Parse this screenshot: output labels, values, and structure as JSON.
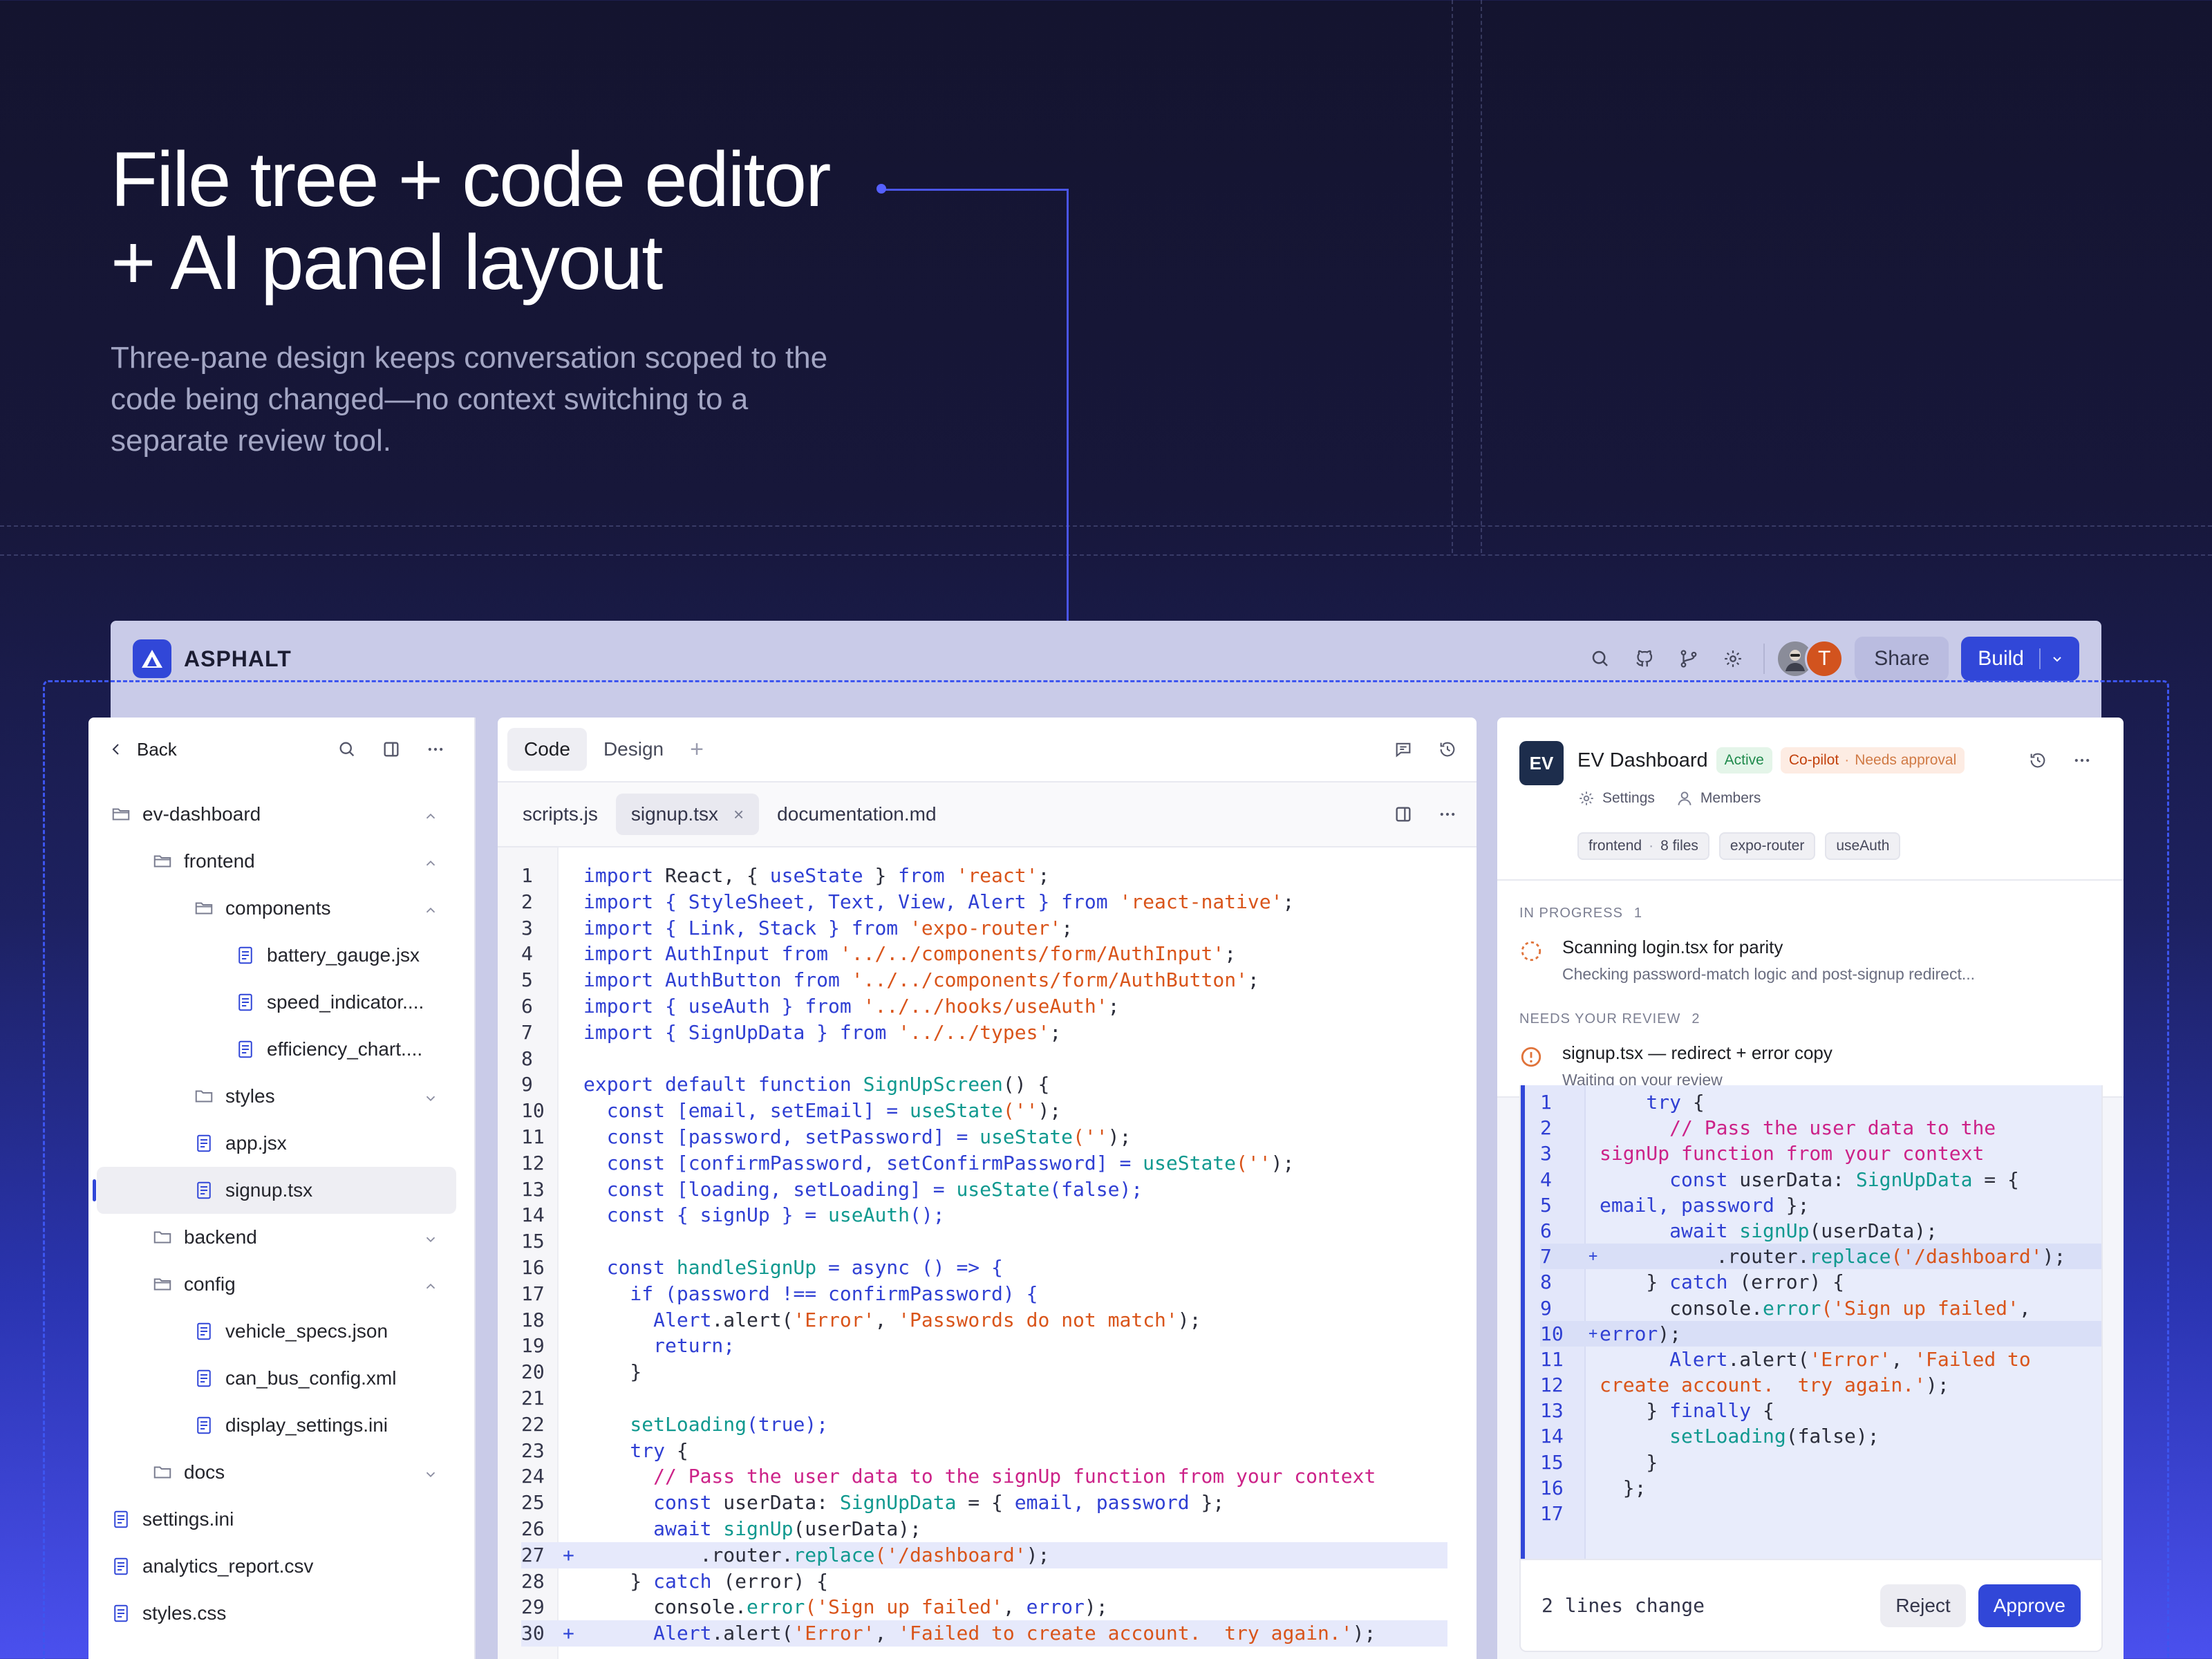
{
  "hero": {
    "title_line1": "File tree + code editor",
    "title_line2": "+ AI panel layout",
    "subtitle": "Three-pane design keeps conversation scoped to the code being changed—no context switching to a separate review tool."
  },
  "app": {
    "brand": "ASPHALT",
    "avatar_initial": "T",
    "share_label": "Share",
    "build_label": "Build"
  },
  "file_tree": {
    "back_label": "Back",
    "items": [
      {
        "label": "ev-dashboard"
      },
      {
        "label": "frontend"
      },
      {
        "label": "components"
      },
      {
        "label": "battery_gauge.jsx"
      },
      {
        "label": "speed_indicator...."
      },
      {
        "label": "efficiency_chart...."
      },
      {
        "label": "styles"
      },
      {
        "label": "app.jsx"
      },
      {
        "label": "signup.tsx"
      },
      {
        "label": "backend"
      },
      {
        "label": "config"
      },
      {
        "label": "vehicle_specs.json"
      },
      {
        "label": "can_bus_config.xml"
      },
      {
        "label": "display_settings.ini"
      },
      {
        "label": "docs"
      },
      {
        "label": "settings.ini"
      },
      {
        "label": "analytics_report.csv"
      },
      {
        "label": "styles.css"
      }
    ]
  },
  "editor": {
    "mode_tabs": [
      "Code",
      "Design"
    ],
    "file_tabs": [
      "scripts.js",
      "signup.tsx",
      "documentation.md"
    ],
    "close_glyph": "×",
    "lines": [
      {
        "n": "1",
        "text": ""
      },
      {
        "n": "2",
        "text": ""
      },
      {
        "n": "3",
        "text": ""
      },
      {
        "n": "4",
        "text": ""
      },
      {
        "n": "5",
        "text": ""
      },
      {
        "n": "6",
        "text": ""
      },
      {
        "n": "7",
        "text": ""
      },
      {
        "n": "8",
        "text": ""
      },
      {
        "n": "9",
        "text": ""
      },
      {
        "n": "10",
        "text": ""
      },
      {
        "n": "11",
        "text": ""
      },
      {
        "n": "12",
        "text": ""
      },
      {
        "n": "13",
        "text": ""
      },
      {
        "n": "14",
        "text": ""
      },
      {
        "n": "15",
        "text": ""
      },
      {
        "n": "16",
        "text": ""
      },
      {
        "n": "17",
        "text": ""
      },
      {
        "n": "18",
        "text": ""
      },
      {
        "n": "19",
        "text": ""
      },
      {
        "n": "20",
        "text": ""
      },
      {
        "n": "21",
        "text": ""
      },
      {
        "n": "22",
        "text": ""
      },
      {
        "n": "23",
        "text": ""
      },
      {
        "n": "24",
        "text": ""
      },
      {
        "n": "25",
        "text": ""
      },
      {
        "n": "26",
        "text": ""
      },
      {
        "n": "27",
        "text": ""
      },
      {
        "n": "28",
        "text": ""
      },
      {
        "n": "29",
        "text": ""
      },
      {
        "n": "30",
        "text": ""
      }
    ]
  },
  "ai_panel": {
    "project_initials": "EV",
    "project_name": "EV Dashboard",
    "status_badge": "Active",
    "copilot_label": "Co-pilot",
    "copilot_state": "Needs approval",
    "settings_label": "Settings",
    "members_label": "Members",
    "tags": [
      "frontend",
      "8 files",
      "expo-router",
      "useAuth"
    ],
    "in_progress_label": "IN PROGRESS",
    "in_progress_count": "1",
    "in_progress_title": "Scanning login.tsx for parity",
    "in_progress_detail": "Checking password-match logic and post-signup redirect...",
    "review_label": "NEEDS YOUR REVIEW",
    "review_count": "2",
    "review_title": "signup.tsx — redirect + error copy",
    "review_detail": "Waiting on your review",
    "diff_summary": "2 lines change",
    "reject_label": "Reject",
    "approve_label": "Approve"
  },
  "colors": {
    "accent": "#3147d8",
    "active_green": "#1f8a4c",
    "copilot_orange": "#c2410c"
  }
}
